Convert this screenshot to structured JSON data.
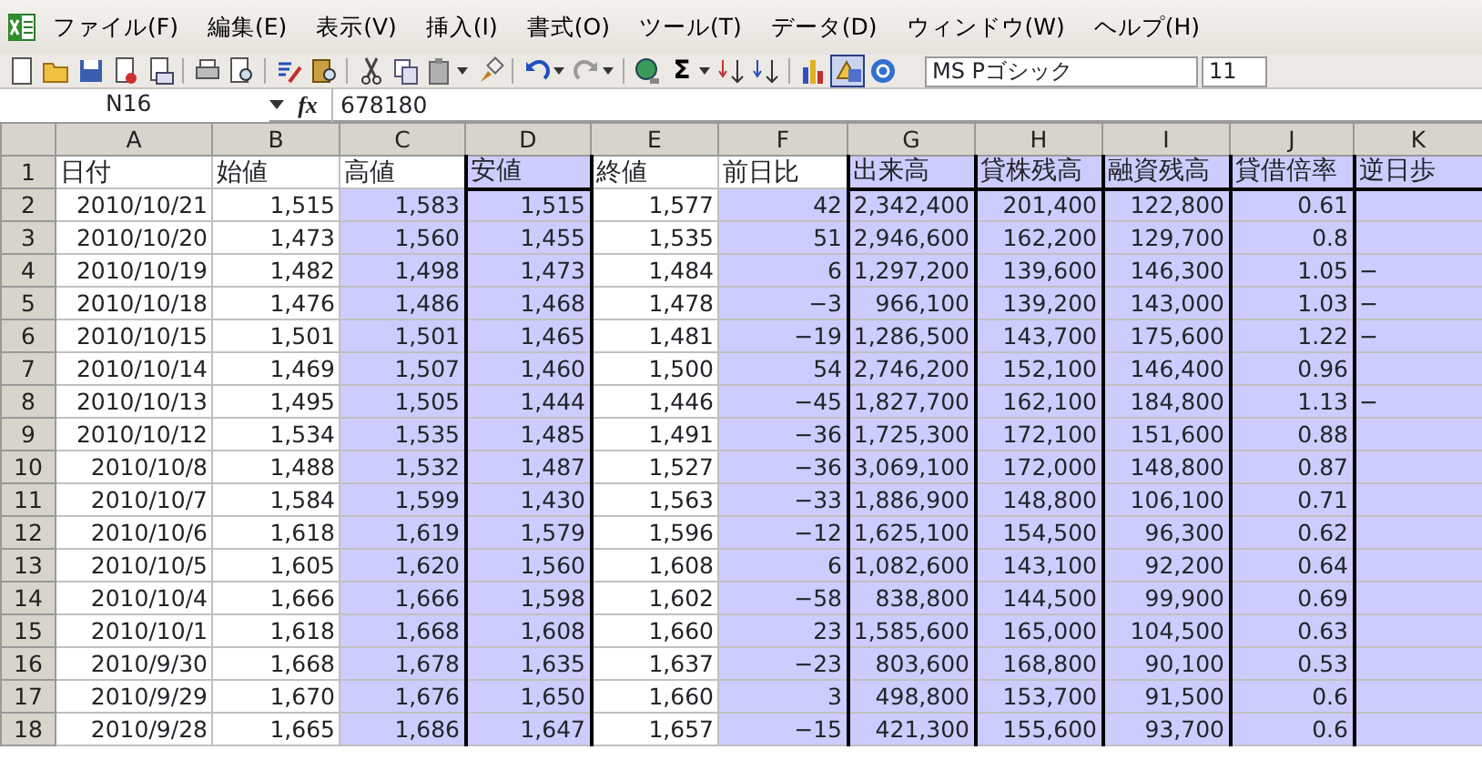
{
  "menu_bar": {
    "items": [
      "ファイル(F)",
      "編集(E)",
      "表示(V)",
      "挿入(I)",
      "書式(O)",
      "ツール(T)",
      "データ(D)",
      "ウィンドウ(W)",
      "ヘルプ(H)"
    ]
  },
  "toolbar": {
    "buttons": [
      {
        "kind": "new",
        "pressed": false
      },
      {
        "kind": "open",
        "pressed": false
      },
      {
        "kind": "save",
        "pressed": false
      },
      {
        "kind": "permission",
        "pressed": false
      },
      {
        "kind": "mail",
        "pressed": false
      },
      {
        "kind": "sep"
      },
      {
        "kind": "print",
        "pressed": false
      },
      {
        "kind": "preview",
        "pressed": false
      },
      {
        "kind": "sep"
      },
      {
        "kind": "spelling",
        "pressed": false
      },
      {
        "kind": "research",
        "pressed": false
      },
      {
        "kind": "sep"
      },
      {
        "kind": "cut",
        "pressed": false
      },
      {
        "kind": "copy",
        "pressed": false
      },
      {
        "kind": "paste",
        "pressed": false
      },
      {
        "kind": "dropdown"
      },
      {
        "kind": "brush",
        "pressed": false
      },
      {
        "kind": "sep"
      },
      {
        "kind": "undo",
        "pressed": false
      },
      {
        "kind": "dropdown"
      },
      {
        "kind": "redo",
        "pressed": false
      },
      {
        "kind": "dropdown"
      },
      {
        "kind": "sep"
      },
      {
        "kind": "globe",
        "pressed": false
      },
      {
        "kind": "sum",
        "label": "Σ",
        "pressed": false
      },
      {
        "kind": "dropdown"
      },
      {
        "kind": "sortup",
        "pressed": false
      },
      {
        "kind": "sortdown",
        "pressed": false
      },
      {
        "kind": "sep"
      },
      {
        "kind": "chart",
        "pressed": false
      },
      {
        "kind": "drawing",
        "pressed": true
      },
      {
        "kind": "help",
        "pressed": false
      }
    ],
    "font_name": "MS Pゴシック",
    "font_size": "11"
  },
  "formula_bar": {
    "name_box": "N16",
    "function_label": "fx",
    "value": "678180"
  },
  "sheet": {
    "columns": [
      {
        "letter": "A",
        "shaded": false,
        "header_shaded": false,
        "outlined": false
      },
      {
        "letter": "B",
        "shaded": false,
        "header_shaded": false,
        "outlined": false
      },
      {
        "letter": "C",
        "shaded": true,
        "header_shaded": false,
        "outlined": false
      },
      {
        "letter": "D",
        "shaded": true,
        "header_shaded": true,
        "outlined": true
      },
      {
        "letter": "E",
        "shaded": false,
        "header_shaded": false,
        "outlined": false
      },
      {
        "letter": "F",
        "shaded": true,
        "header_shaded": false,
        "outlined": false
      },
      {
        "letter": "G",
        "shaded": true,
        "header_shaded": true,
        "outlined": true
      },
      {
        "letter": "H",
        "shaded": true,
        "header_shaded": true,
        "outlined": true
      },
      {
        "letter": "I",
        "shaded": true,
        "header_shaded": true,
        "outlined": true
      },
      {
        "letter": "J",
        "shaded": true,
        "header_shaded": true,
        "outlined": true
      },
      {
        "letter": "K",
        "shaded": true,
        "header_shaded": true,
        "outlined": false,
        "left_aligned": true
      }
    ],
    "rows": [
      {
        "number": "1",
        "cells": [
          "日付",
          "始値",
          "高値",
          "安値",
          "終値",
          "前日比",
          "出来高",
          "貸株残高",
          "融資残高",
          "貸借倍率",
          "逆日歩"
        ]
      },
      {
        "number": "2",
        "cells": [
          "2010/10/21",
          "1,515",
          "1,583",
          "1,515",
          "1,577",
          "42",
          "2,342,400",
          "201,400",
          "122,800",
          "0.61",
          ""
        ]
      },
      {
        "number": "3",
        "cells": [
          "2010/10/20",
          "1,473",
          "1,560",
          "1,455",
          "1,535",
          "51",
          "2,946,600",
          "162,200",
          "129,700",
          "0.8",
          ""
        ]
      },
      {
        "number": "4",
        "cells": [
          "2010/10/19",
          "1,482",
          "1,498",
          "1,473",
          "1,484",
          "6",
          "1,297,200",
          "139,600",
          "146,300",
          "1.05",
          "−"
        ]
      },
      {
        "number": "5",
        "cells": [
          "2010/10/18",
          "1,476",
          "1,486",
          "1,468",
          "1,478",
          "−3",
          "966,100",
          "139,200",
          "143,000",
          "1.03",
          "−"
        ]
      },
      {
        "number": "6",
        "cells": [
          "2010/10/15",
          "1,501",
          "1,501",
          "1,465",
          "1,481",
          "−19",
          "1,286,500",
          "143,700",
          "175,600",
          "1.22",
          "−"
        ]
      },
      {
        "number": "7",
        "cells": [
          "2010/10/14",
          "1,469",
          "1,507",
          "1,460",
          "1,500",
          "54",
          "2,746,200",
          "152,100",
          "146,400",
          "0.96",
          ""
        ]
      },
      {
        "number": "8",
        "cells": [
          "2010/10/13",
          "1,495",
          "1,505",
          "1,444",
          "1,446",
          "−45",
          "1,827,700",
          "162,100",
          "184,800",
          "1.13",
          "−"
        ]
      },
      {
        "number": "9",
        "cells": [
          "2010/10/12",
          "1,534",
          "1,535",
          "1,485",
          "1,491",
          "−36",
          "1,725,300",
          "172,100",
          "151,600",
          "0.88",
          ""
        ]
      },
      {
        "number": "10",
        "cells": [
          "2010/10/8",
          "1,488",
          "1,532",
          "1,487",
          "1,527",
          "−36",
          "3,069,100",
          "172,000",
          "148,800",
          "0.87",
          ""
        ]
      },
      {
        "number": "11",
        "cells": [
          "2010/10/7",
          "1,584",
          "1,599",
          "1,430",
          "1,563",
          "−33",
          "1,886,900",
          "148,800",
          "106,100",
          "0.71",
          ""
        ]
      },
      {
        "number": "12",
        "cells": [
          "2010/10/6",
          "1,618",
          "1,619",
          "1,579",
          "1,596",
          "−12",
          "1,625,100",
          "154,500",
          "96,300",
          "0.62",
          ""
        ]
      },
      {
        "number": "13",
        "cells": [
          "2010/10/5",
          "1,605",
          "1,620",
          "1,560",
          "1,608",
          "6",
          "1,082,600",
          "143,100",
          "92,200",
          "0.64",
          ""
        ]
      },
      {
        "number": "14",
        "cells": [
          "2010/10/4",
          "1,666",
          "1,666",
          "1,598",
          "1,602",
          "−58",
          "838,800",
          "144,500",
          "99,900",
          "0.69",
          ""
        ]
      },
      {
        "number": "15",
        "cells": [
          "2010/10/1",
          "1,618",
          "1,668",
          "1,608",
          "1,660",
          "23",
          "1,585,600",
          "165,000",
          "104,500",
          "0.63",
          ""
        ]
      },
      {
        "number": "16",
        "cells": [
          "2010/9/30",
          "1,668",
          "1,678",
          "1,635",
          "1,637",
          "−23",
          "803,600",
          "168,800",
          "90,100",
          "0.53",
          ""
        ]
      },
      {
        "number": "17",
        "cells": [
          "2010/9/29",
          "1,670",
          "1,676",
          "1,650",
          "1,660",
          "3",
          "498,800",
          "153,700",
          "91,500",
          "0.6",
          ""
        ]
      },
      {
        "number": "18",
        "cells": [
          "2010/9/28",
          "1,665",
          "1,686",
          "1,647",
          "1,657",
          "−15",
          "421,300",
          "155,600",
          "93,700",
          "0.6",
          ""
        ]
      }
    ]
  }
}
